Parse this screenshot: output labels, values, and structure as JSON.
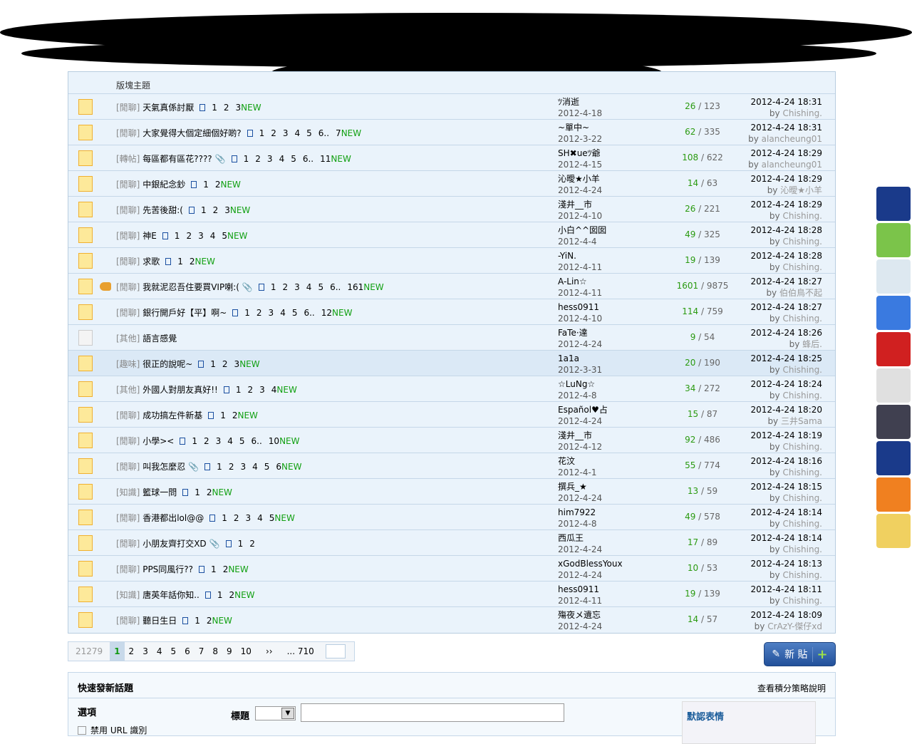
{
  "header": {
    "column_title": "版塊主題"
  },
  "colors": {
    "new": "#11a011",
    "replies": "#2a9a10",
    "category": "#888888"
  },
  "threads": [
    {
      "cat": "[閒聊]",
      "title": "天氣真係討厭",
      "attach": false,
      "hot": false,
      "pages": [
        "1",
        "2",
        "3"
      ],
      "new": "NEW",
      "author": "ﾂ消逝",
      "date": "2012-4-18",
      "replies": "26",
      "views": "123",
      "last_time": "2012-4-24 18:31",
      "last_by": "Chishing."
    },
    {
      "cat": "[閒聊]",
      "title": "大家覺得大個定細個好啲?",
      "attach": false,
      "hot": false,
      "pages": [
        "1",
        "2",
        "3",
        "4",
        "5",
        "6..",
        "7"
      ],
      "new": "NEW",
      "author": "~單中~",
      "date": "2012-3-22",
      "replies": "62",
      "views": "335",
      "last_time": "2012-4-24 18:31",
      "last_by": "alancheung01"
    },
    {
      "cat": "[轉帖]",
      "title": "每區都有區花????",
      "attach": true,
      "hot": false,
      "pages": [
        "1",
        "2",
        "3",
        "4",
        "5",
        "6..",
        "11"
      ],
      "new": "NEW",
      "author": "SH✖ueﾂ爺",
      "date": "2012-4-15",
      "replies": "108",
      "views": "622",
      "last_time": "2012-4-24 18:29",
      "last_by": "alancheung01"
    },
    {
      "cat": "[閒聊]",
      "title": "中銀紀念鈔",
      "attach": false,
      "hot": false,
      "pages": [
        "1",
        "2"
      ],
      "new": "NEW",
      "author": "沁曖★小羊",
      "date": "2012-4-24",
      "replies": "14",
      "views": "63",
      "last_time": "2012-4-24 18:29",
      "last_by": "沁曖★小羊"
    },
    {
      "cat": "[閒聊]",
      "title": "先苦後甜:(",
      "attach": false,
      "hot": false,
      "pages": [
        "1",
        "2",
        "3"
      ],
      "new": "NEW",
      "author": "淺井__市",
      "date": "2012-4-10",
      "replies": "26",
      "views": "221",
      "last_time": "2012-4-24 18:29",
      "last_by": "Chishing."
    },
    {
      "cat": "[閒聊]",
      "title": "神E",
      "attach": false,
      "hot": false,
      "pages": [
        "1",
        "2",
        "3",
        "4",
        "5"
      ],
      "new": "NEW",
      "author": "小白^^囡囡",
      "date": "2012-4-4",
      "replies": "49",
      "views": "325",
      "last_time": "2012-4-24 18:28",
      "last_by": "Chishing."
    },
    {
      "cat": "[閒聊]",
      "title": "求歌",
      "attach": false,
      "hot": false,
      "pages": [
        "1",
        "2"
      ],
      "new": "NEW",
      "author": "-YiN.",
      "date": "2012-4-11",
      "replies": "19",
      "views": "139",
      "last_time": "2012-4-24 18:28",
      "last_by": "Chishing."
    },
    {
      "cat": "[閒聊]",
      "title": "我就泥忍吾住要買VIP喇:(",
      "attach": true,
      "hot": true,
      "pages": [
        "1",
        "2",
        "3",
        "4",
        "5",
        "6..",
        "161"
      ],
      "new": "NEW",
      "author": "A-Lin☆",
      "date": "2012-4-11",
      "replies": "1601",
      "views": "9875",
      "last_time": "2012-4-24 18:27",
      "last_by": "伯伯鳥不起"
    },
    {
      "cat": "[閒聊]",
      "title": "銀行開戶好【平】啊~",
      "attach": false,
      "hot": false,
      "pages": [
        "1",
        "2",
        "3",
        "4",
        "5",
        "6..",
        "12"
      ],
      "new": "NEW",
      "author": "hess0911",
      "date": "2012-4-10",
      "replies": "114",
      "views": "759",
      "last_time": "2012-4-24 18:27",
      "last_by": "Chishing."
    },
    {
      "cat": "[其他]",
      "title": "語言感覺",
      "attach": false,
      "hot": false,
      "old": true,
      "pages": [],
      "new": "",
      "author": "FaTe·達",
      "date": "2012-4-24",
      "replies": "9",
      "views": "54",
      "last_time": "2012-4-24 18:26",
      "last_by": "蜂后."
    },
    {
      "cat": "[趣味]",
      "title": "很正的說呢~",
      "attach": false,
      "hot": false,
      "highlight": true,
      "pages": [
        "1",
        "2",
        "3"
      ],
      "new": "NEW",
      "author": "1a1a",
      "date": "2012-3-31",
      "replies": "20",
      "views": "190",
      "last_time": "2012-4-24 18:25",
      "last_by": "Chishing."
    },
    {
      "cat": "[其他]",
      "title": "外國人對朋友真好!!",
      "attach": false,
      "hot": false,
      "pages": [
        "1",
        "2",
        "3",
        "4"
      ],
      "new": "NEW",
      "author": "☆LuNg☆",
      "date": "2012-4-8",
      "replies": "34",
      "views": "272",
      "last_time": "2012-4-24 18:24",
      "last_by": "Chishing."
    },
    {
      "cat": "[閒聊]",
      "title": "成功搞左件新基",
      "attach": false,
      "hot": false,
      "pages": [
        "1",
        "2"
      ],
      "new": "NEW",
      "author": "Español♥占",
      "date": "2012-4-24",
      "replies": "15",
      "views": "87",
      "last_time": "2012-4-24 18:20",
      "last_by": "三井Sama"
    },
    {
      "cat": "[閒聊]",
      "title": "小學><",
      "attach": false,
      "hot": false,
      "pages": [
        "1",
        "2",
        "3",
        "4",
        "5",
        "6..",
        "10"
      ],
      "new": "NEW",
      "author": "淺井__市",
      "date": "2012-4-12",
      "replies": "92",
      "views": "486",
      "last_time": "2012-4-24 18:19",
      "last_by": "Chishing."
    },
    {
      "cat": "[閒聊]",
      "title": "叫我怎麼忍",
      "attach": true,
      "hot": false,
      "pages": [
        "1",
        "2",
        "3",
        "4",
        "5",
        "6"
      ],
      "new": "NEW",
      "author": "花汶",
      "date": "2012-4-1",
      "replies": "55",
      "views": "774",
      "last_time": "2012-4-24 18:16",
      "last_by": "Chishing."
    },
    {
      "cat": "[知識]",
      "title": "籃球一問",
      "attach": false,
      "hot": false,
      "pages": [
        "1",
        "2"
      ],
      "new": "NEW",
      "author": "撰兵_★",
      "date": "2012-4-24",
      "replies": "13",
      "views": "59",
      "last_time": "2012-4-24 18:15",
      "last_by": "Chishing."
    },
    {
      "cat": "[閒聊]",
      "title": "香港都出lol@@",
      "attach": false,
      "hot": false,
      "pages": [
        "1",
        "2",
        "3",
        "4",
        "5"
      ],
      "new": "NEW",
      "author": "him7922",
      "date": "2012-4-8",
      "replies": "49",
      "views": "578",
      "last_time": "2012-4-24 18:14",
      "last_by": "Chishing."
    },
    {
      "cat": "[閒聊]",
      "title": "小朋友齊打交XD",
      "attach": true,
      "hot": false,
      "pages": [
        "1",
        "2"
      ],
      "new": "",
      "author": "西瓜王",
      "date": "2012-4-24",
      "replies": "17",
      "views": "89",
      "last_time": "2012-4-24 18:14",
      "last_by": "Chishing."
    },
    {
      "cat": "[閒聊]",
      "title": "PPS同風行??",
      "attach": false,
      "hot": false,
      "pages": [
        "1",
        "2"
      ],
      "new": "NEW",
      "author": "xGodBlessYoux",
      "date": "2012-4-24",
      "replies": "10",
      "views": "53",
      "last_time": "2012-4-24 18:13",
      "last_by": "Chishing."
    },
    {
      "cat": "[知識]",
      "title": "唐英年話你知..",
      "attach": false,
      "hot": false,
      "pages": [
        "1",
        "2"
      ],
      "new": "NEW",
      "author": "hess0911",
      "date": "2012-4-11",
      "replies": "19",
      "views": "139",
      "last_time": "2012-4-24 18:11",
      "last_by": "Chishing."
    },
    {
      "cat": "[閒聊]",
      "title": "聽日生日",
      "attach": false,
      "hot": false,
      "pages": [
        "1",
        "2"
      ],
      "new": "NEW",
      "author": "殤夜メ遺忘",
      "date": "2012-4-24",
      "replies": "14",
      "views": "57",
      "last_time": "2012-4-24 18:09",
      "last_by": "CrAzY-傑仔xd"
    }
  ],
  "pager": {
    "total": "21279",
    "current": "1",
    "pages": [
      "2",
      "3",
      "4",
      "5",
      "6",
      "7",
      "8",
      "9",
      "10"
    ],
    "next": "››",
    "last": "... 710"
  },
  "new_post_button": {
    "label": "新 貼",
    "plus": "+"
  },
  "quick_post": {
    "title": "快速發新話題",
    "policy_link": "查看積分策略說明",
    "options_label": "選項",
    "disable_url": "禁用 URL 識別",
    "subject_label": "標題",
    "select_arrow": "▼",
    "smilies_label": "默認表情"
  },
  "game_bar": {
    "tiles": [
      "#1a3a8a",
      "#7bc44a",
      "#dde8f0",
      "#3a7ae0",
      "#d02020",
      "#e0e0e0",
      "#404050",
      "#1a3a8a",
      "#f08020",
      "#f0d060"
    ]
  }
}
